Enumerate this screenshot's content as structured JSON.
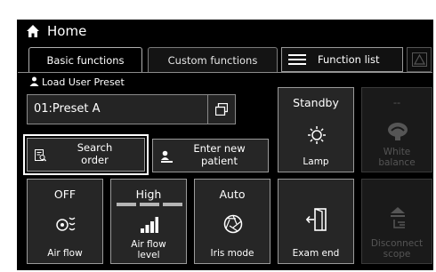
{
  "title": "Home",
  "tabs": [
    "Basic functions",
    "Custom functions"
  ],
  "function_list_label": "Function list",
  "load_preset": {
    "label": "Load User Preset",
    "value": "01:Preset A"
  },
  "search_order": {
    "line1": "Search",
    "line2": "order"
  },
  "enter_patient": {
    "line1": "Enter new",
    "line2": "patient"
  },
  "lamp": {
    "status": "Standby",
    "label": "Lamp"
  },
  "white_balance": {
    "status": "--",
    "line1": "White",
    "line2": "balance"
  },
  "air_flow": {
    "status": "OFF",
    "label": "Air flow"
  },
  "air_flow_level": {
    "status": "High",
    "line1": "Air flow",
    "line2": "level"
  },
  "iris_mode": {
    "status": "Auto",
    "label": "Iris mode"
  },
  "exam_end": {
    "label": "Exam end"
  },
  "disconnect_scope": {
    "line1": "Disconnect",
    "line2": "scope"
  },
  "colors": {
    "background": "#000000",
    "button": "#262626",
    "border": "#9a9a9a",
    "disabled": "#555555"
  }
}
